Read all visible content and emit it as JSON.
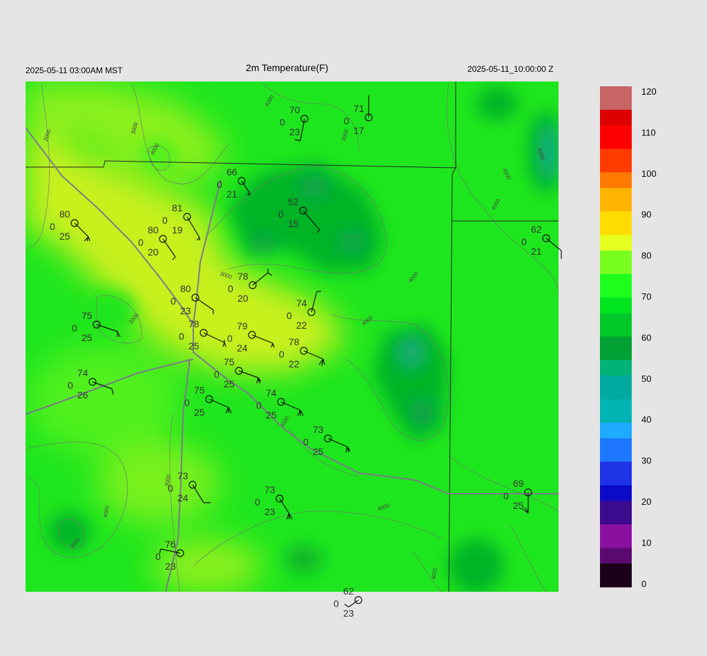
{
  "header": {
    "local_time": "2025-05-11 03:00AM MST",
    "title": "2m Temperature(F)",
    "utc_time": "2025-05-11_10:00:00 Z"
  },
  "colorbar": {
    "labels": [
      "120",
      "110",
      "100",
      "90",
      "80",
      "70",
      "60",
      "50",
      "40",
      "30",
      "20",
      "10",
      "0"
    ],
    "stops": [
      {
        "v": 0,
        "c": "#1a0018"
      },
      {
        "v": 5,
        "c": "#5a0a6e"
      },
      {
        "v": 10,
        "c": "#8c10a0"
      },
      {
        "v": 15,
        "c": "#3c0a8c"
      },
      {
        "v": 20,
        "c": "#0a0ac8"
      },
      {
        "v": 25,
        "c": "#1e32e6"
      },
      {
        "v": 30,
        "c": "#1e78ff"
      },
      {
        "v": 35,
        "c": "#1eaaff"
      },
      {
        "v": 40,
        "c": "#00b4b4"
      },
      {
        "v": 45,
        "c": "#00aaa0"
      },
      {
        "v": 50,
        "c": "#00b478"
      },
      {
        "v": 55,
        "c": "#00a032"
      },
      {
        "v": 60,
        "c": "#00c828"
      },
      {
        "v": 65,
        "c": "#00e61e"
      },
      {
        "v": 70,
        "c": "#1eff1e"
      },
      {
        "v": 75,
        "c": "#78ff1e"
      },
      {
        "v": 80,
        "c": "#e6ff1e"
      },
      {
        "v": 85,
        "c": "#ffdc00"
      },
      {
        "v": 90,
        "c": "#ffb400"
      },
      {
        "v": 95,
        "c": "#ff7800"
      },
      {
        "v": 100,
        "c": "#ff3c00"
      },
      {
        "v": 105,
        "c": "#ff0000"
      },
      {
        "v": 110,
        "c": "#dc0000"
      },
      {
        "v": 115,
        "c": "#c86464"
      },
      {
        "v": 120,
        "c": "#e6c8c8"
      }
    ]
  },
  "contour_labels": [
    "2000",
    "3000",
    "4000",
    "3000",
    "3000",
    "4000",
    "3000",
    "4000",
    "4000",
    "4000",
    "4000",
    "4000",
    "3000",
    "4000",
    "3000",
    "4000",
    "4000",
    "3000"
  ],
  "stations": [
    {
      "temp": "66",
      "q": "0",
      "dew": "21"
    },
    {
      "temp": "70",
      "q": "0",
      "dew": "23"
    },
    {
      "temp": "71",
      "q": "0",
      "dew": "17"
    },
    {
      "temp": "52",
      "q": "0",
      "dew": "15"
    },
    {
      "temp": "80",
      "q": "0",
      "dew": "25"
    },
    {
      "temp": "81",
      "q": "0",
      "dew": "19"
    },
    {
      "temp": "80",
      "q": "0",
      "dew": "20"
    },
    {
      "temp": "62",
      "q": "0",
      "dew": "21"
    },
    {
      "temp": "78",
      "q": "0",
      "dew": "20"
    },
    {
      "temp": "80",
      "q": "0",
      "dew": "23"
    },
    {
      "temp": "74",
      "q": "0",
      "dew": "22"
    },
    {
      "temp": "75",
      "q": "0",
      "dew": "25"
    },
    {
      "temp": "78",
      "q": "0",
      "dew": "25"
    },
    {
      "temp": "79",
      "q": "0",
      "dew": "24"
    },
    {
      "temp": "78",
      "q": "0",
      "dew": "22"
    },
    {
      "temp": "75",
      "q": "0",
      "dew": "25"
    },
    {
      "temp": "74",
      "q": "0",
      "dew": "26"
    },
    {
      "temp": "75",
      "q": "0",
      "dew": "25"
    },
    {
      "temp": "74",
      "q": "0",
      "dew": "25"
    },
    {
      "temp": "73",
      "q": "0",
      "dew": "25"
    },
    {
      "temp": "73",
      "q": "0",
      "dew": "24"
    },
    {
      "temp": "73",
      "q": "0",
      "dew": "23"
    },
    {
      "temp": "69",
      "q": "0",
      "dew": "25"
    },
    {
      "temp": "76",
      "q": "0",
      "dew": "23"
    },
    {
      "temp": "62",
      "q": "0",
      "dew": "23"
    }
  ]
}
